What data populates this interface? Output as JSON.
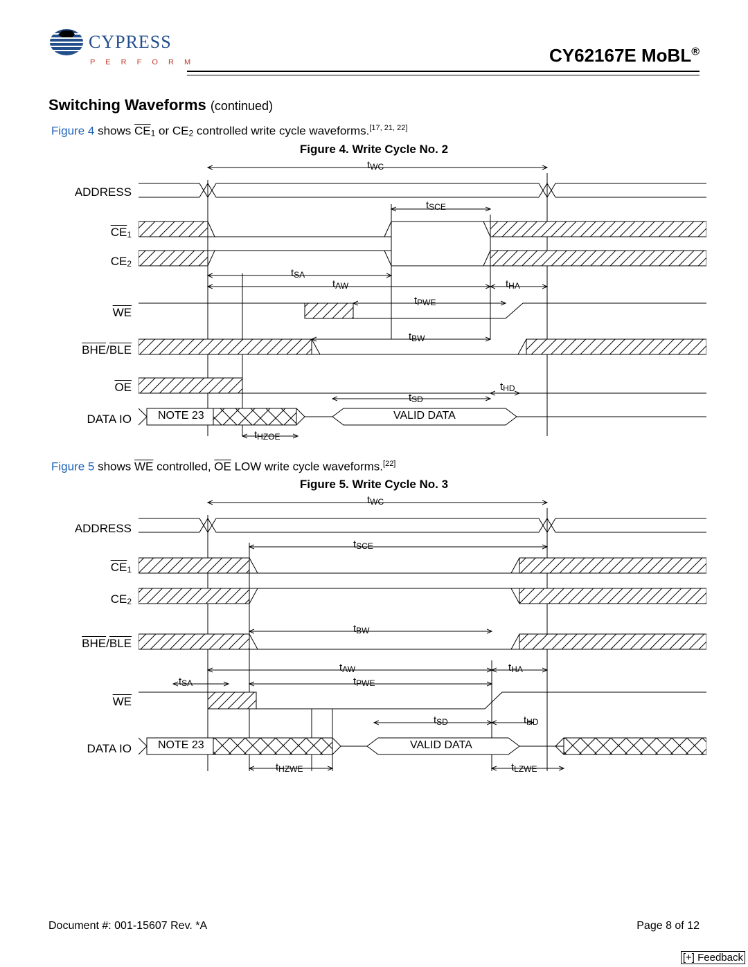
{
  "header": {
    "brand": "CYPRESS",
    "tagline": "P E R F O R M",
    "part": "CY62167E MoBL",
    "reg": "®"
  },
  "section": {
    "title": "Switching Waveforms",
    "continued": "(continued)"
  },
  "desc1": {
    "figref": "Figure 4",
    "mid1": " shows ",
    "ce1": "CE",
    "sub1": "1",
    "mid2": " or CE",
    "sub2": "2",
    "mid3": " controlled write cycle waveforms.",
    "sup": "[17, 21, 22]"
  },
  "fig4": {
    "caption": "Figure 4. Write Cycle No. 2",
    "rows": {
      "address": "ADDRESS",
      "ce1": "CE",
      "ce1sub": "1",
      "ce2": "CE",
      "ce2sub": "2",
      "we": "WE",
      "bhe": "BHE",
      "ble": "BLE",
      "oe": "OE",
      "data": "DATA IO"
    },
    "timing": {
      "twc": "t",
      "twc_sub": "WC",
      "tsce": "t",
      "tsce_sub": "SCE",
      "tsa": "t",
      "tsa_sub": "SA",
      "taw": "t",
      "taw_sub": "AW",
      "tha": "t",
      "tha_sub": "HA",
      "tpwe": "t",
      "tpwe_sub": "PWE",
      "tbw": "t",
      "tbw_sub": "BW",
      "thd": "t",
      "thd_sub": "HD",
      "tsd": "t",
      "tsd_sub": "SD",
      "thzoe": "t",
      "thzoe_sub": "HZOE"
    },
    "data": {
      "note": "NOTE 23",
      "valid": "VALID DATA"
    }
  },
  "desc2": {
    "figref": "Figure 5",
    "mid1": " shows ",
    "we": "WE",
    "mid2": " controlled, ",
    "oe": "OE",
    "mid3": " LOW write cycle waveforms.",
    "sup": "[22]"
  },
  "fig5": {
    "caption": "Figure 5. Write Cycle No. 3",
    "rows": {
      "address": "ADDRESS",
      "ce1": "CE",
      "ce1sub": "1",
      "ce2": "CE",
      "ce2sub": "2",
      "bhe": "BHE",
      "ble": "BLE",
      "we": "WE",
      "data": "DATA IO"
    },
    "timing": {
      "twc": "t",
      "twc_sub": "WC",
      "tsce": "t",
      "tsce_sub": "SCE",
      "tbw": "t",
      "tbw_sub": "BW",
      "taw": "t",
      "taw_sub": "AW",
      "tha": "t",
      "tha_sub": "HA",
      "tsa": "t",
      "tsa_sub": "SA",
      "tpwe": "t",
      "tpwe_sub": "PWE",
      "tsd": "t",
      "tsd_sub": "SD",
      "thd": "t",
      "thd_sub": "HD",
      "thzwe": "t",
      "thzwe_sub": "HZWE",
      "tlzwe": "t",
      "tlzwe_sub": "LZWE"
    },
    "data": {
      "note": "NOTE 23",
      "valid": "VALID DATA"
    }
  },
  "footer": {
    "docnum": "Document #: 001-15607 Rev. *A",
    "page": "Page 8 of 12"
  },
  "feedback": "[+] Feedback"
}
